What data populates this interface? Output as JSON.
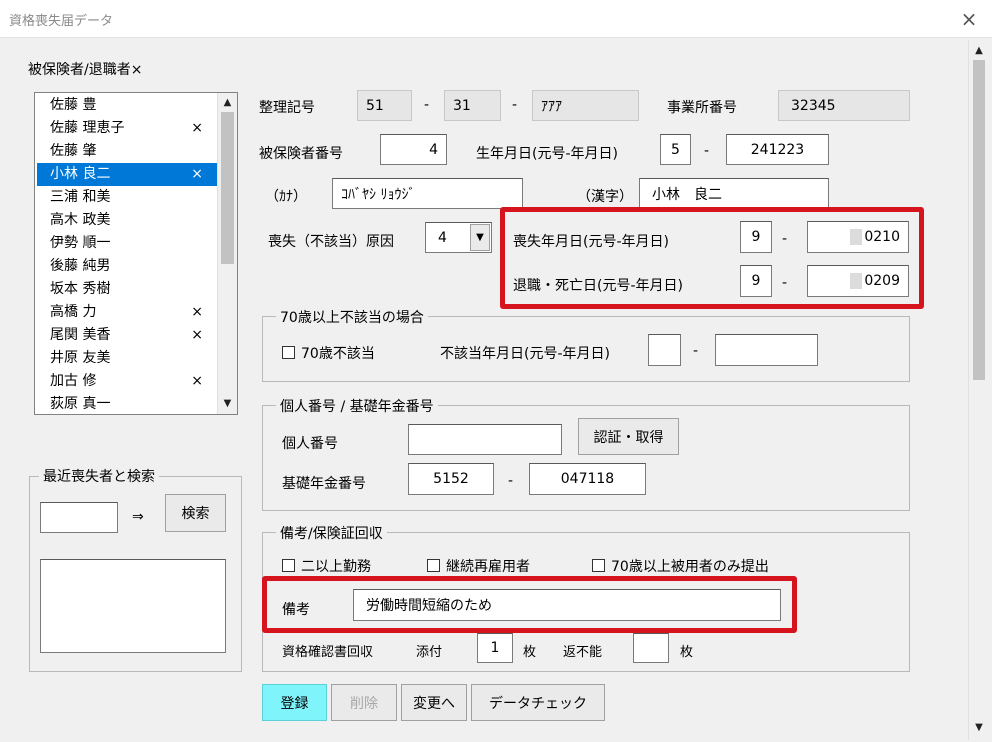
{
  "window": {
    "title": "資格喪失届データ",
    "close_icon": "×"
  },
  "list_section": {
    "label": "被保険者/退職者×",
    "items": [
      {
        "name": "佐藤 豊",
        "mark": ""
      },
      {
        "name": "佐藤 理恵子",
        "mark": "×"
      },
      {
        "name": "佐藤 肇",
        "mark": ""
      },
      {
        "name": "小林 良二",
        "mark": "×"
      },
      {
        "name": "三浦 和美",
        "mark": ""
      },
      {
        "name": "高木 政美",
        "mark": ""
      },
      {
        "name": "伊勢 順一",
        "mark": ""
      },
      {
        "name": "後藤 純男",
        "mark": ""
      },
      {
        "name": "坂本 秀樹",
        "mark": ""
      },
      {
        "name": "高橋 力",
        "mark": "×"
      },
      {
        "name": "尾関 美香",
        "mark": "×"
      },
      {
        "name": "井原 友美",
        "mark": ""
      },
      {
        "name": "加古 修",
        "mark": "×"
      },
      {
        "name": "荻原 真一",
        "mark": ""
      }
    ],
    "selected_index": 3
  },
  "recent_search": {
    "caption": "最近喪失者と検索",
    "input_value": "",
    "arrow": "⇒",
    "search_button": "検索"
  },
  "form": {
    "seiri_label": "整理記号",
    "seiri_1": "51",
    "seiri_dash1": "-",
    "seiri_2": "31",
    "seiri_dash2": "-",
    "seiri_3": "ｱｱｱ",
    "jigyosho_label": "事業所番号",
    "jigyosho_value": "32345",
    "hihoken_label": "被保険者番号",
    "hihoken_value": "4",
    "birth_label": "生年月日(元号-年月日)",
    "birth_era": "5",
    "birth_dash": "-",
    "birth_date": "241223",
    "kana_label": "（ｶﾅ）",
    "kana_value": "ｺﾊﾞﾔｼ ﾘｮｳｼﾞ",
    "kanji_label": "（漢字）",
    "kanji_value": "小林　良二",
    "cause_label": "喪失（不該当）原因",
    "cause_value": "4",
    "loss_label": "喪失年月日(元号-年月日)",
    "loss_era": "9",
    "loss_dash": "-",
    "loss_date": "0210",
    "retire_label": "退職・死亡日(元号-年月日)",
    "retire_era": "9",
    "retire_dash": "-",
    "retire_date": "0209"
  },
  "over70": {
    "caption": "70歳以上不該当の場合",
    "checkbox_label": "70歳不該当",
    "checked": false,
    "date_label": "不該当年月日(元号-年月日)",
    "era": "",
    "dash": "-",
    "date": ""
  },
  "mynumber": {
    "caption": "個人番号 / 基礎年金番号",
    "kojin_label": "個人番号",
    "kojin_value": "",
    "auth_button": "認証・取得",
    "kiso_label": "基礎年金番号",
    "kiso_1": "5152",
    "kiso_dash": "-",
    "kiso_2": "047118"
  },
  "remarks": {
    "caption": "備考/保険証回収",
    "cb1": "二以上勤務",
    "cb2": "継続再雇用者",
    "cb3": "70歳以上被用者のみ提出",
    "biko_label": "備考",
    "biko_value": "労働時間短縮のため",
    "kaishu_label": "資格確認書回収",
    "tenpu_label": "添付",
    "tenpu_value": "1",
    "mai1": "枚",
    "henfuno_label": "返不能",
    "henfuno_value": "",
    "mai2": "枚"
  },
  "actions": {
    "register": "登録",
    "delete": "削除",
    "change": "変更へ",
    "datacheck": "データチェック"
  },
  "colors": {
    "highlight_red": "#d6141d",
    "selection_blue": "#0078d7",
    "register_bg": "#7ff4fb"
  }
}
